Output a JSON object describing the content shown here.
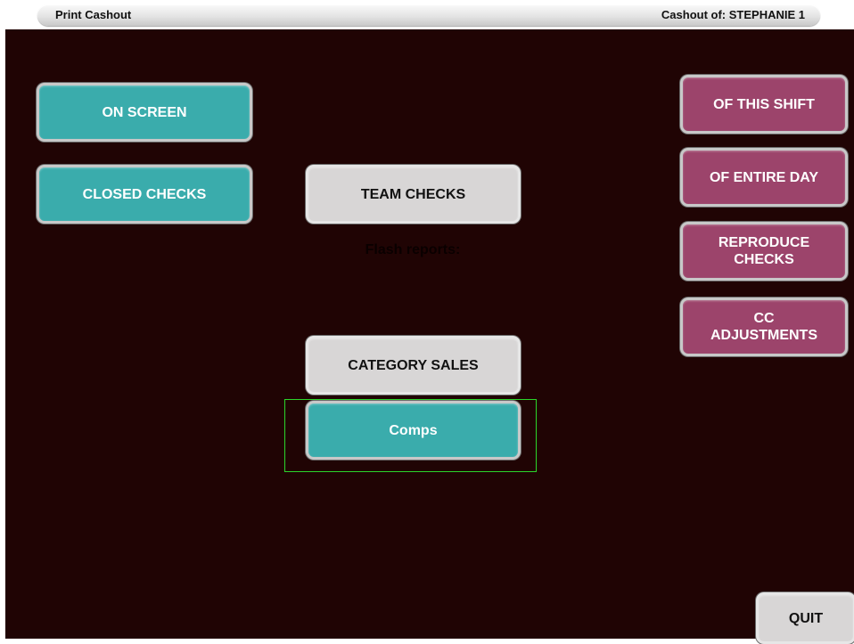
{
  "header": {
    "title": "Print Cashout",
    "cashout_of": "Cashout of: STEPHANIE 1"
  },
  "left_buttons": {
    "on_screen": "ON SCREEN",
    "closed_checks": "CLOSED CHECKS"
  },
  "center": {
    "team_checks": "TEAM CHECKS",
    "flash_reports_label": "Flash reports:",
    "category_sales": "CATEGORY SALES",
    "comps": "Comps"
  },
  "right_buttons": {
    "of_this_shift": "OF THIS SHIFT",
    "of_entire_day": "OF ENTIRE DAY",
    "reproduce_checks": "REPRODUCE\nCHECKS",
    "cc_adjustments": "CC\nADJUSTMENTS"
  },
  "footer": {
    "quit": "QUIT"
  },
  "colors": {
    "background": "#200404",
    "teal_button": "#3aacac",
    "gray_button": "#d8d6d6",
    "plum_button": "#9c446b",
    "focus_outline": "#2bd62b"
  }
}
